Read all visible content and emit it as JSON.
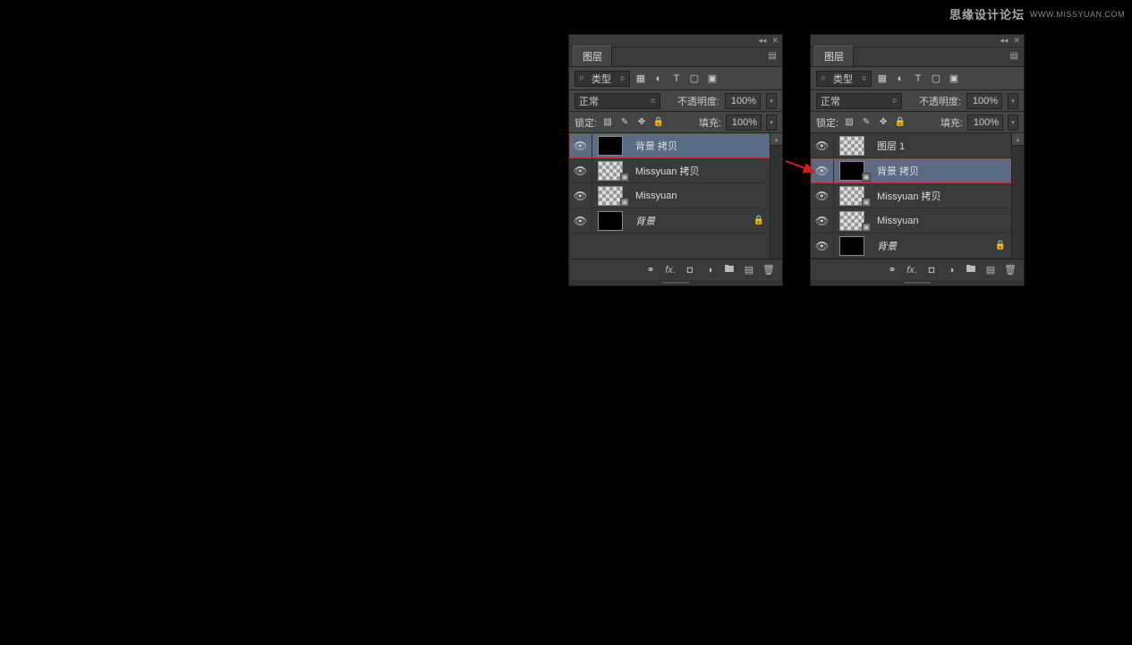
{
  "watermark": {
    "text": "思缘设计论坛",
    "url": "WWW.MISSYUAN.COM"
  },
  "common": {
    "tab_title": "图层",
    "filter_label": "类型",
    "blend_mode": "正常",
    "opacity_label": "不透明度:",
    "opacity_value": "100%",
    "lock_label": "锁定:",
    "fill_label": "填充:",
    "fill_value": "100%"
  },
  "panels": {
    "left": {
      "layers": [
        {
          "name": "背景 拷贝",
          "selected": true,
          "highlighted": true,
          "thumb": "black",
          "italic": false,
          "badge": false,
          "locked": false
        },
        {
          "name": "Missyuan 拷贝",
          "selected": false,
          "highlighted": false,
          "thumb": "checker",
          "italic": false,
          "badge": true,
          "locked": false
        },
        {
          "name": "Missyuan",
          "selected": false,
          "highlighted": false,
          "thumb": "checker",
          "italic": false,
          "badge": true,
          "locked": false
        },
        {
          "name": "背景",
          "selected": false,
          "highlighted": false,
          "thumb": "black",
          "italic": true,
          "badge": false,
          "locked": true
        }
      ]
    },
    "right": {
      "layers": [
        {
          "name": "图层 1",
          "selected": false,
          "highlighted": false,
          "thumb": "checker",
          "italic": false,
          "badge": false,
          "locked": false
        },
        {
          "name": "背景 拷贝",
          "selected": true,
          "highlighted": true,
          "thumb": "black",
          "italic": false,
          "badge": true,
          "locked": false
        },
        {
          "name": "Missyuan 拷贝",
          "selected": false,
          "highlighted": false,
          "thumb": "checker",
          "italic": false,
          "badge": true,
          "locked": false
        },
        {
          "name": "Missyuan",
          "selected": false,
          "highlighted": false,
          "thumb": "checker",
          "italic": false,
          "badge": true,
          "locked": false
        },
        {
          "name": "背景",
          "selected": false,
          "highlighted": false,
          "thumb": "black",
          "italic": true,
          "badge": false,
          "locked": true
        }
      ]
    }
  }
}
